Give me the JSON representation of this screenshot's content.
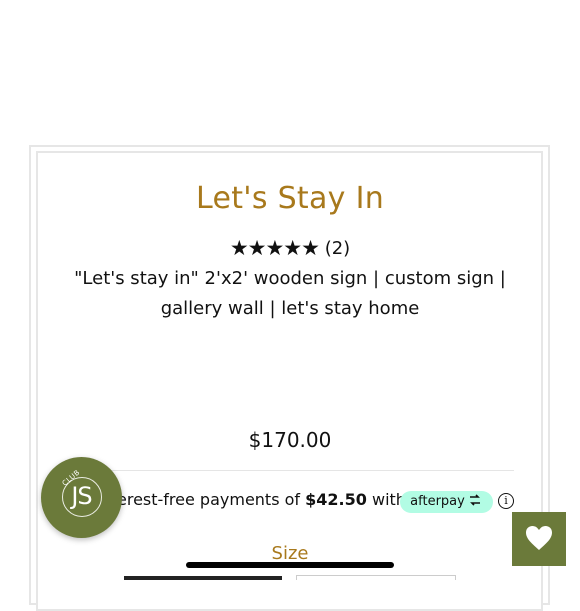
{
  "product": {
    "title": "Let's Stay In",
    "stars": "★★★★★",
    "review_count": "(2)",
    "rating_value": 5,
    "description": "\"Let's stay in\" 2'x2' wooden sign | custom sign | gallery wall | let's stay home",
    "price": "$170.00"
  },
  "payments": {
    "text_prefix": "erest-free payments of ",
    "amount": "$42.50",
    "text_suffix": " with",
    "provider": "afterpay",
    "provider_color": "#b2fce4",
    "info_icon": "i"
  },
  "size": {
    "label": "Size"
  },
  "badge": {
    "initials": "JS",
    "word": "CLUB",
    "color": "#6b7a3a"
  },
  "favorite": {
    "icon": "heart-icon",
    "color": "#6b7a3a"
  },
  "accent": "#a8791c"
}
